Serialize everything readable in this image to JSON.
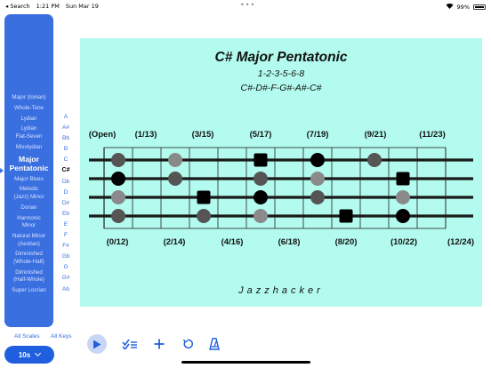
{
  "status_bar": {
    "back_label": "◂ Search",
    "time": "1:21 PM",
    "date": "Sun Mar 19",
    "dots": "•••",
    "battery_pct": "99%"
  },
  "sidebar": {
    "scales": [
      {
        "label": "Major (Ionian)",
        "selected": false
      },
      {
        "label": "Whole-Tone",
        "selected": false
      },
      {
        "label": "Lydian",
        "selected": false
      },
      {
        "label": "Lydian\nFlat-Seven",
        "selected": false
      },
      {
        "label": "Mixolydian",
        "selected": false
      },
      {
        "label": "Major\nPentatonic",
        "selected": true
      },
      {
        "label": "Major Blues",
        "selected": false
      },
      {
        "label": "Melodic\n(Jazz) Minor",
        "selected": false
      },
      {
        "label": "Dorian",
        "selected": false
      },
      {
        "label": "Harmonic\nMinor",
        "selected": false
      },
      {
        "label": "Natural Minor\n(Aeolian)",
        "selected": false
      },
      {
        "label": "Diminished\n(Whole-Half)",
        "selected": false
      },
      {
        "label": "Diminished\n(Half-Whole)",
        "selected": false
      },
      {
        "label": "Super Locrian",
        "selected": false
      }
    ]
  },
  "keys": [
    {
      "label": "A",
      "selected": false
    },
    {
      "label": "A#",
      "selected": false
    },
    {
      "label": "Bb",
      "selected": false
    },
    {
      "label": "B",
      "selected": false
    },
    {
      "label": "C",
      "selected": false
    },
    {
      "label": "C#",
      "selected": true
    },
    {
      "label": "Db",
      "selected": false
    },
    {
      "label": "D",
      "selected": false
    },
    {
      "label": "D#",
      "selected": false
    },
    {
      "label": "Eb",
      "selected": false
    },
    {
      "label": "E",
      "selected": false
    },
    {
      "label": "F",
      "selected": false
    },
    {
      "label": "F#",
      "selected": false
    },
    {
      "label": "Gb",
      "selected": false
    },
    {
      "label": "G",
      "selected": false
    },
    {
      "label": "G#",
      "selected": false
    },
    {
      "label": "Ab",
      "selected": false
    }
  ],
  "bottom": {
    "all_scales": "All Scales",
    "all_keys": "All Keys",
    "tempo_label": "10s"
  },
  "card": {
    "title": "C# Major Pentatonic",
    "formula": "1-2-3-5-6-8",
    "notes": "C#-D#-F-G#-A#-C#",
    "brand": "Jazzhacker",
    "top_fret_labels": [
      "(Open)",
      "(1/13)",
      "(3/15)",
      "(5/17)",
      "(7/19)",
      "(9/21)",
      "(11/23)"
    ],
    "bottom_fret_labels": [
      "(0/12)",
      "(2/14)",
      "(4/16)",
      "(6/18)",
      "(8/20)",
      "(10/22)",
      "(12/24)"
    ]
  },
  "fretboard": {
    "frets": 12,
    "strings": 4,
    "notes": [
      {
        "string": 1,
        "fret": 1,
        "shape": "circle",
        "tone": "dark"
      },
      {
        "string": 1,
        "fret": 3,
        "shape": "circle",
        "tone": "gray"
      },
      {
        "string": 1,
        "fret": 6,
        "shape": "square",
        "tone": "black"
      },
      {
        "string": 1,
        "fret": 8,
        "shape": "circle",
        "tone": "black"
      },
      {
        "string": 1,
        "fret": 10,
        "shape": "circle",
        "tone": "dark"
      },
      {
        "string": 2,
        "fret": 1,
        "shape": "circle",
        "tone": "black"
      },
      {
        "string": 2,
        "fret": 3,
        "shape": "circle",
        "tone": "dark"
      },
      {
        "string": 2,
        "fret": 6,
        "shape": "circle",
        "tone": "dark"
      },
      {
        "string": 2,
        "fret": 8,
        "shape": "circle",
        "tone": "gray"
      },
      {
        "string": 2,
        "fret": 11,
        "shape": "square",
        "tone": "black"
      },
      {
        "string": 3,
        "fret": 1,
        "shape": "circle",
        "tone": "gray"
      },
      {
        "string": 3,
        "fret": 4,
        "shape": "square",
        "tone": "black"
      },
      {
        "string": 3,
        "fret": 6,
        "shape": "circle",
        "tone": "black"
      },
      {
        "string": 3,
        "fret": 8,
        "shape": "circle",
        "tone": "dark"
      },
      {
        "string": 3,
        "fret": 11,
        "shape": "circle",
        "tone": "gray"
      },
      {
        "string": 4,
        "fret": 1,
        "shape": "circle",
        "tone": "dark"
      },
      {
        "string": 4,
        "fret": 4,
        "shape": "circle",
        "tone": "dark"
      },
      {
        "string": 4,
        "fret": 6,
        "shape": "circle",
        "tone": "gray"
      },
      {
        "string": 4,
        "fret": 9,
        "shape": "square",
        "tone": "black"
      },
      {
        "string": 4,
        "fret": 11,
        "shape": "circle",
        "tone": "black"
      }
    ]
  },
  "colors": {
    "accent": "#3a6fe0",
    "card_bg": "#b3fbee",
    "note_black": "#000000",
    "note_dark": "#555555",
    "note_gray": "#8a8a8a"
  }
}
